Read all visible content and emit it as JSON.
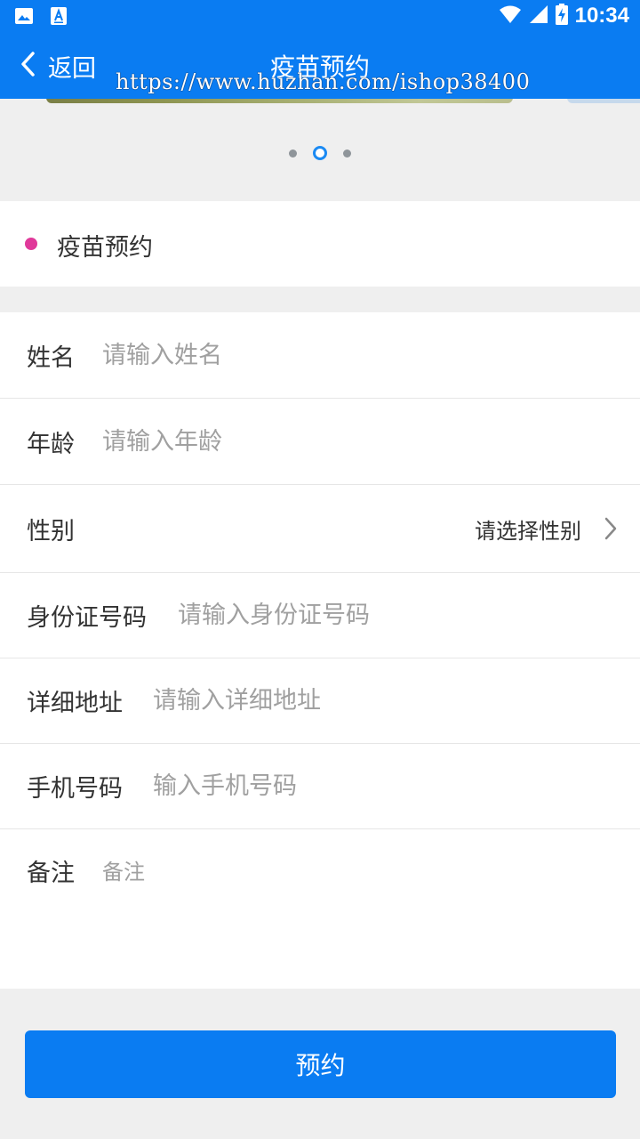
{
  "status_bar": {
    "time": "10:34",
    "icons": [
      "image-icon",
      "accessibility-a-icon",
      "wifi-icon",
      "signal-icon",
      "battery-charging-icon"
    ]
  },
  "nav": {
    "back_label": "返回",
    "title": "疫苗预约"
  },
  "watermark": "https://www.huzhan.com/ishop38400",
  "carousel": {
    "slide_count": 3,
    "active_index": 1
  },
  "section": {
    "title": "疫苗预约",
    "dot_color": "#e0399a"
  },
  "form": {
    "name": {
      "label": "姓名",
      "placeholder": "请输入姓名"
    },
    "age": {
      "label": "年龄",
      "placeholder": "请输入年龄"
    },
    "gender": {
      "label": "性别",
      "value": "请选择性别"
    },
    "id_number": {
      "label": "身份证号码",
      "placeholder": "请输入身份证号码"
    },
    "address": {
      "label": "详细地址",
      "placeholder": "请输入详细地址"
    },
    "phone": {
      "label": "手机号码",
      "placeholder": "输入手机号码"
    },
    "remark": {
      "label": "备注",
      "placeholder": "备注"
    }
  },
  "submit_label": "预约",
  "colors": {
    "primary": "#0a7cf2",
    "background": "#efefef",
    "placeholder": "#a0a0a0"
  }
}
